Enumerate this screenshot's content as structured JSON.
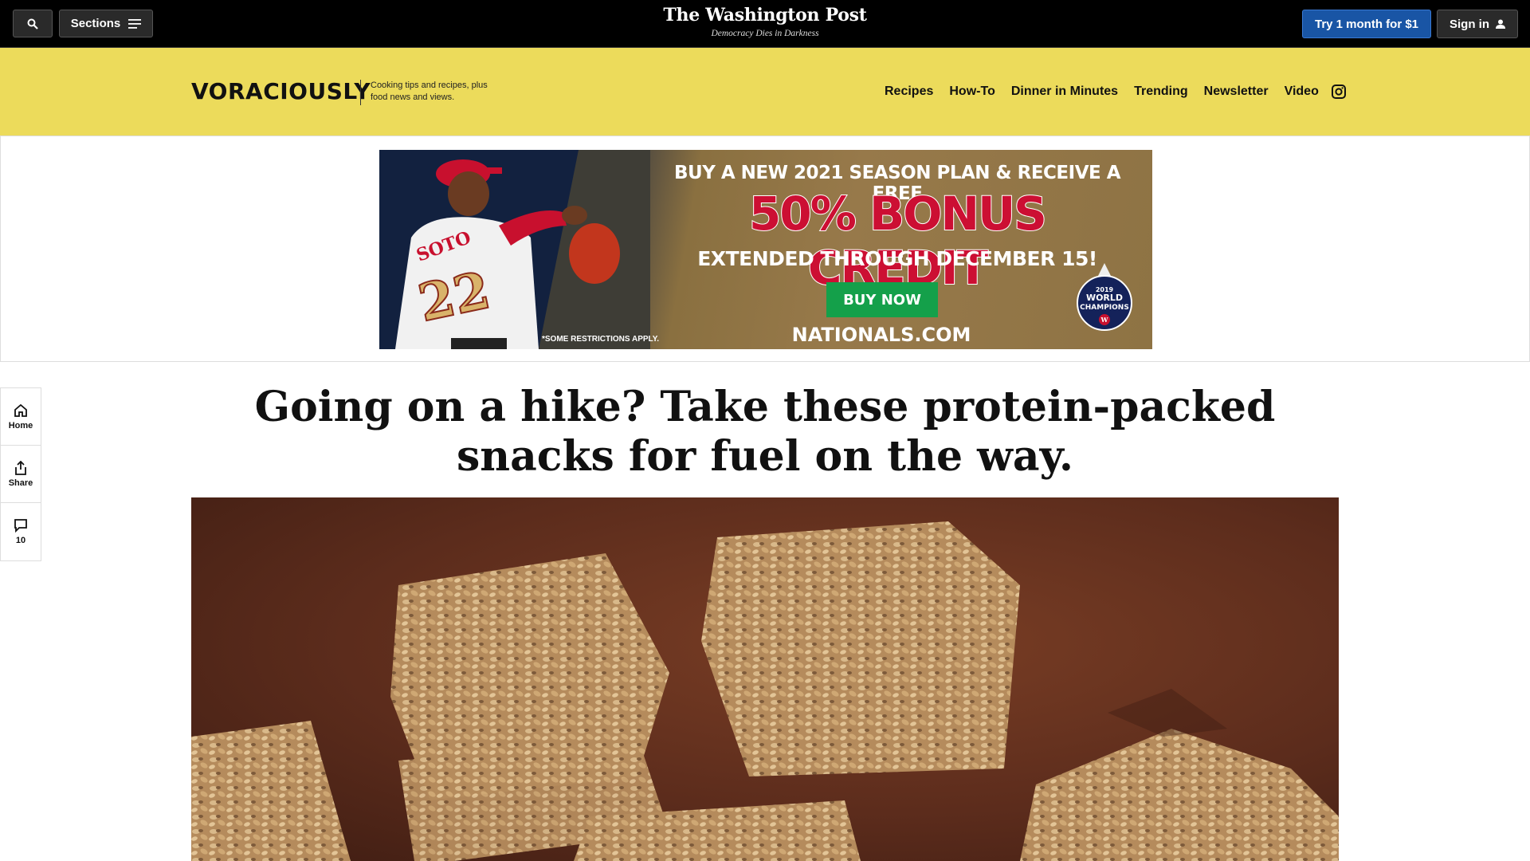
{
  "topbar": {
    "sections_label": "Sections",
    "masthead_title": "The Washington Post",
    "masthead_tagline": "Democracy Dies in Darkness",
    "try_label": "Try 1 month for $1",
    "signin_label": "Sign in"
  },
  "voraciously": {
    "logo": "VORACIOUSLY",
    "description": "Cooking tips and recipes, plus food news and views.",
    "nav": [
      "Recipes",
      "How-To",
      "Dinner in Minutes",
      "Trending",
      "Newsletter",
      "Video"
    ],
    "icons": {
      "instagram": "instagram-icon"
    }
  },
  "ad": {
    "line1": "BUY A NEW 2021 SEASON PLAN & RECEIVE A FREE",
    "line2": "50% BONUS CREDIT",
    "line3": "EXTENDED THROUGH DECEMBER 15!",
    "button": "BUY NOW",
    "site": "NATIONALS.COM",
    "restrictions": "*SOME RESTRICTIONS APPLY.",
    "jersey_name": "SOTO",
    "jersey_number": "22",
    "badge_year": "2019",
    "badge_line1": "WORLD",
    "badge_line2": "CHAMPIONS",
    "colors": {
      "navy": "#12213f",
      "gold": "#97794a",
      "red": "#cc0f33",
      "green": "#14a04a"
    }
  },
  "rail": {
    "home_label": "Home",
    "share_label": "Share",
    "comments_count": "10"
  },
  "article": {
    "headline": "Going on a hike? Take these protein-packed snacks for fuel on the way."
  },
  "colors": {
    "topbar_bg": "#000000",
    "accent_blue": "#1955a5",
    "band_yellow": "#ecdb5b"
  }
}
